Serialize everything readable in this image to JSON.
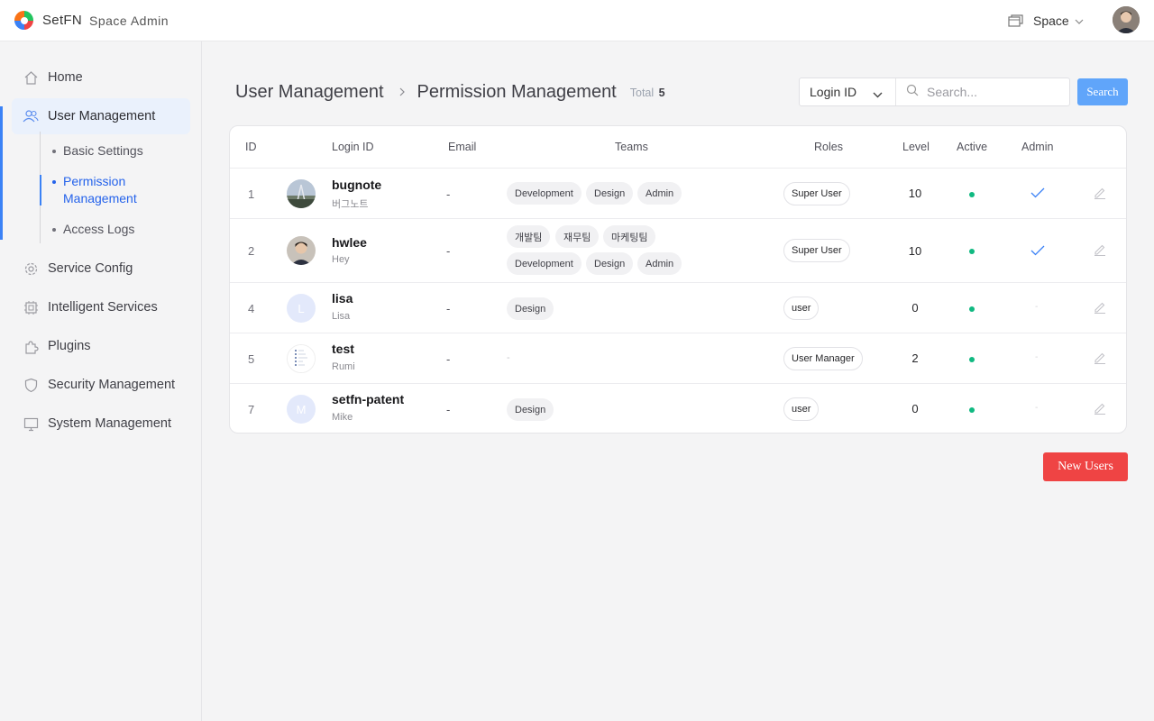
{
  "app": {
    "brand": "SetFN",
    "subtitle": "Space Admin"
  },
  "topbar": {
    "space_label": "Space",
    "space_icon": "window-stack-icon"
  },
  "sidebar": {
    "items": [
      {
        "label": "Home",
        "icon": "home-icon"
      },
      {
        "label": "User Management",
        "icon": "users-icon"
      },
      {
        "label": "Service Config",
        "icon": "gear-icon"
      },
      {
        "label": "Intelligent Services",
        "icon": "chip-icon"
      },
      {
        "label": "Plugins",
        "icon": "puzzle-icon"
      },
      {
        "label": "Security Management",
        "icon": "shield-icon"
      },
      {
        "label": "System Management",
        "icon": "monitor-icon"
      }
    ],
    "sub_items": [
      {
        "label": "Basic Settings"
      },
      {
        "label": "Permission Management"
      },
      {
        "label": "Access Logs"
      }
    ]
  },
  "header": {
    "crumb_parent": "User Management",
    "crumb_current": "Permission Management",
    "total_label": "Total",
    "total_count": "5"
  },
  "search": {
    "field_select": "Login ID",
    "placeholder": "Search...",
    "button": "Search"
  },
  "table": {
    "columns": [
      "ID",
      "Login ID",
      "Email",
      "Teams",
      "Roles",
      "Level",
      "Active",
      "Admin"
    ],
    "rows": [
      {
        "id": "1",
        "login": "bugnote",
        "display": "버그노트",
        "email": "-",
        "teams": [
          "Development",
          "Design",
          "Admin"
        ],
        "role": "Super User",
        "level": "10",
        "active": true,
        "admin": true
      },
      {
        "id": "2",
        "login": "hwlee",
        "display": "Hey",
        "email": "-",
        "teams": [
          "개발팀",
          "재무팀",
          "마케팅팀",
          "Development",
          "Design",
          "Admin"
        ],
        "role": "Super User",
        "level": "10",
        "active": true,
        "admin": true
      },
      {
        "id": "4",
        "login": "lisa",
        "display": "Lisa",
        "avatar_letter": "L",
        "email": "-",
        "teams": [
          "Design"
        ],
        "role": "user",
        "level": "0",
        "active": true,
        "admin": false
      },
      {
        "id": "5",
        "login": "test",
        "display": "Rumi",
        "email": "-",
        "teams": [],
        "teams_empty": "-",
        "role": "User Manager",
        "level": "2",
        "active": true,
        "admin": false
      },
      {
        "id": "7",
        "login": "setfn-patent",
        "display": "Mike",
        "avatar_letter": "M",
        "email": "-",
        "teams": [
          "Design"
        ],
        "role": "user",
        "level": "0",
        "active": true,
        "admin": false
      }
    ],
    "admin_empty": "-"
  },
  "actions": {
    "new_users": "New Users"
  },
  "colors": {
    "accent": "#3b82f6",
    "search_button": "#60a5fa",
    "danger": "#ef4444",
    "active_dot": "#10b981"
  }
}
